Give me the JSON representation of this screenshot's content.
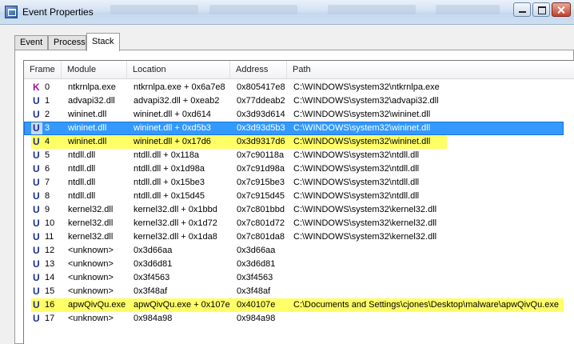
{
  "window": {
    "title": "Event Properties"
  },
  "tabs": [
    {
      "label": "Event",
      "active": false
    },
    {
      "label": "Process",
      "active": false
    },
    {
      "label": "Stack",
      "active": true
    }
  ],
  "columns": {
    "frame": "Frame",
    "module": "Module",
    "location": "Location",
    "address": "Address",
    "path": "Path"
  },
  "colors": {
    "kernel_frame": "#a11399",
    "user_frame": "#1c2e8c",
    "highlight_yellow": "#ffff66",
    "selection_blue": "#3399ff"
  },
  "rows": [
    {
      "type": "K",
      "frame": "0",
      "module": "ntkrnlpa.exe",
      "location": "ntkrnlpa.exe + 0x6a7e8",
      "address": "0x805417e8",
      "path": "C:\\WINDOWS\\system32\\ntkrnlpa.exe",
      "state": ""
    },
    {
      "type": "U",
      "frame": "1",
      "module": "advapi32.dll",
      "location": "advapi32.dll + 0xeab2",
      "address": "0x77ddeab2",
      "path": "C:\\WINDOWS\\system32\\advapi32.dll",
      "state": ""
    },
    {
      "type": "U",
      "frame": "2",
      "module": "wininet.dll",
      "location": "wininet.dll + 0xd614",
      "address": "0x3d93d614",
      "path": "C:\\WINDOWS\\system32\\wininet.dll",
      "state": ""
    },
    {
      "type": "U",
      "frame": "3",
      "module": "wininet.dll",
      "location": "wininet.dll + 0xd5b3",
      "address": "0x3d93d5b3",
      "path": "C:\\WINDOWS\\system32\\wininet.dll",
      "state": "selected"
    },
    {
      "type": "U",
      "frame": "4",
      "module": "wininet.dll",
      "location": "wininet.dll + 0x17d6",
      "address": "0x3d9317d6",
      "path": "C:\\WINDOWS\\system32\\wininet.dll",
      "state": "highlighted"
    },
    {
      "type": "U",
      "frame": "5",
      "module": "ntdll.dll",
      "location": "ntdll.dll + 0x118a",
      "address": "0x7c90118a",
      "path": "C:\\WINDOWS\\system32\\ntdll.dll",
      "state": ""
    },
    {
      "type": "U",
      "frame": "6",
      "module": "ntdll.dll",
      "location": "ntdll.dll + 0x1d98a",
      "address": "0x7c91d98a",
      "path": "C:\\WINDOWS\\system32\\ntdll.dll",
      "state": ""
    },
    {
      "type": "U",
      "frame": "7",
      "module": "ntdll.dll",
      "location": "ntdll.dll + 0x15be3",
      "address": "0x7c915be3",
      "path": "C:\\WINDOWS\\system32\\ntdll.dll",
      "state": ""
    },
    {
      "type": "U",
      "frame": "8",
      "module": "ntdll.dll",
      "location": "ntdll.dll + 0x15d45",
      "address": "0x7c915d45",
      "path": "C:\\WINDOWS\\system32\\ntdll.dll",
      "state": ""
    },
    {
      "type": "U",
      "frame": "9",
      "module": "kernel32.dll",
      "location": "kernel32.dll + 0x1bbd",
      "address": "0x7c801bbd",
      "path": "C:\\WINDOWS\\system32\\kernel32.dll",
      "state": ""
    },
    {
      "type": "U",
      "frame": "10",
      "module": "kernel32.dll",
      "location": "kernel32.dll + 0x1d72",
      "address": "0x7c801d72",
      "path": "C:\\WINDOWS\\system32\\kernel32.dll",
      "state": ""
    },
    {
      "type": "U",
      "frame": "11",
      "module": "kernel32.dll",
      "location": "kernel32.dll + 0x1da8",
      "address": "0x7c801da8",
      "path": "C:\\WINDOWS\\system32\\kernel32.dll",
      "state": ""
    },
    {
      "type": "U",
      "frame": "12",
      "module": "<unknown>",
      "location": "0x3d66aa",
      "address": "0x3d66aa",
      "path": "",
      "state": ""
    },
    {
      "type": "U",
      "frame": "13",
      "module": "<unknown>",
      "location": "0x3d6d81",
      "address": "0x3d6d81",
      "path": "",
      "state": ""
    },
    {
      "type": "U",
      "frame": "14",
      "module": "<unknown>",
      "location": "0x3f4563",
      "address": "0x3f4563",
      "path": "",
      "state": ""
    },
    {
      "type": "U",
      "frame": "15",
      "module": "<unknown>",
      "location": "0x3f48af",
      "address": "0x3f48af",
      "path": "",
      "state": ""
    },
    {
      "type": "U",
      "frame": "16",
      "module": "apwQivQu.exe",
      "location": "apwQivQu.exe + 0x107e",
      "address": "0x40107e",
      "path": "C:\\Documents and Settings\\cjones\\Desktop\\malware\\apwQivQu.exe",
      "state": "highlighted"
    },
    {
      "type": "U",
      "frame": "17",
      "module": "<unknown>",
      "location": "0x984a98",
      "address": "0x984a98",
      "path": "",
      "state": ""
    }
  ]
}
